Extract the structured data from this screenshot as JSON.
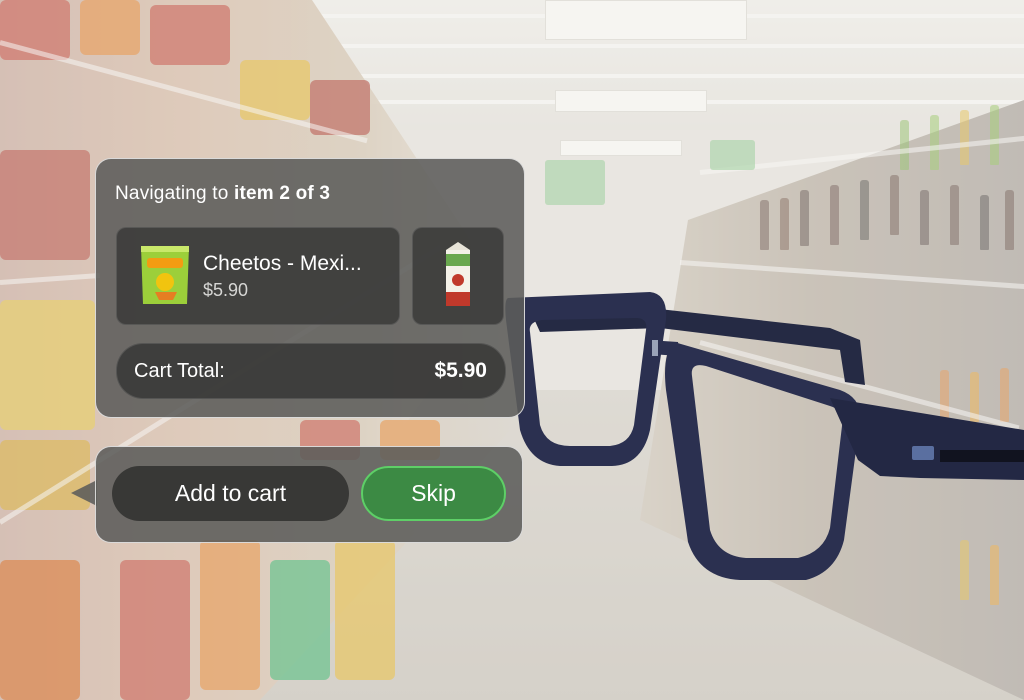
{
  "navigation": {
    "title_prefix": "Navigating to ",
    "title_emphasis": "item 2 of 3"
  },
  "current_item": {
    "name": "Cheetos - Mexi...",
    "price": "$5.90",
    "thumbnail": "cheetos-bag-icon",
    "color": "#9ccf3a"
  },
  "next_item": {
    "thumbnail": "milk-carton-icon",
    "color": "#c0392b"
  },
  "cart": {
    "label": "Cart Total:",
    "total": "$5.90"
  },
  "actions": {
    "add_label": "Add to cart",
    "skip_label": "Skip",
    "skip_color": "#3c8a44"
  },
  "device": {
    "icon": "smart-glasses-icon"
  }
}
